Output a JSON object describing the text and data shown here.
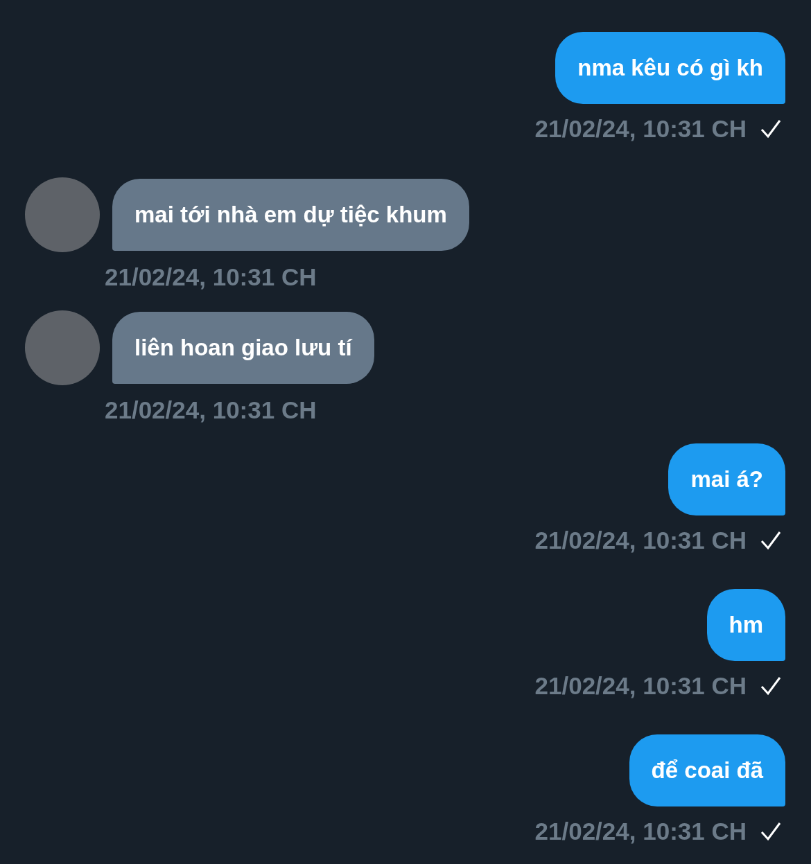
{
  "messages": [
    {
      "kind": "sent",
      "text": "nma kêu có gì kh",
      "time": "21/02/24, 10:31 CH",
      "delivered": true
    },
    {
      "kind": "received",
      "text": "mai tới nhà em dự tiệc khum",
      "time": "21/02/24, 10:31 CH"
    },
    {
      "kind": "received",
      "text": "liên hoan giao lưu tí",
      "time": "21/02/24, 10:31 CH"
    },
    {
      "kind": "sent",
      "text": "mai á?",
      "time": "21/02/24, 10:31 CH",
      "delivered": true
    },
    {
      "kind": "sent",
      "text": "hm",
      "time": "21/02/24, 10:31 CH",
      "delivered": true
    },
    {
      "kind": "sent",
      "text": "để coai đã",
      "time": "21/02/24, 10:31 CH",
      "delivered": true
    }
  ]
}
